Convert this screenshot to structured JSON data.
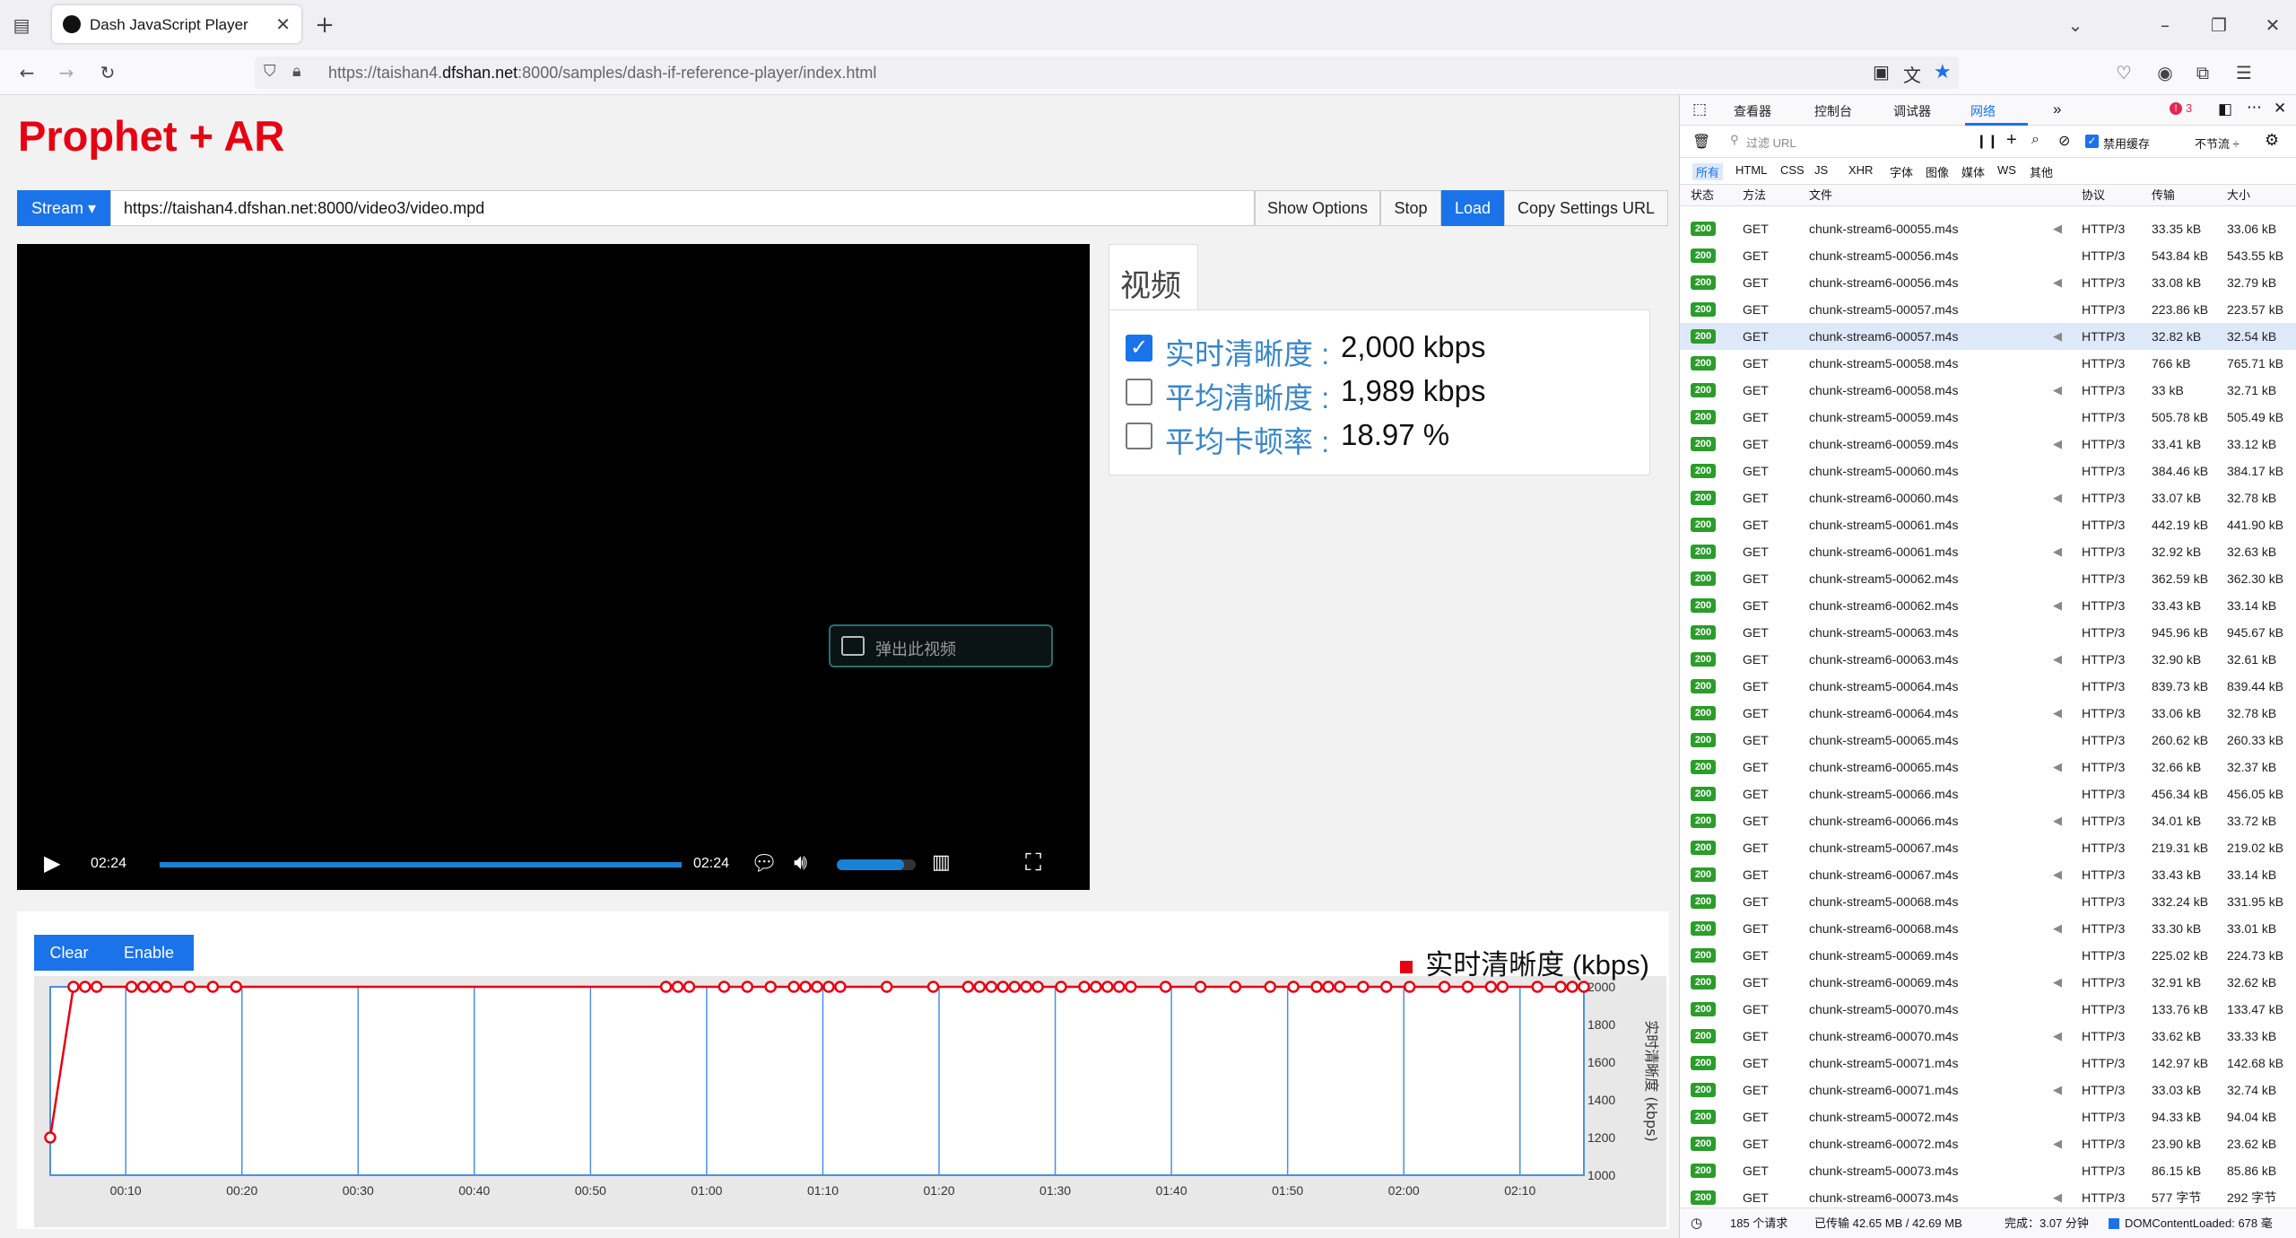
{
  "browser": {
    "tab_title": "Dash JavaScript Player",
    "url_prefix": "https://taishan4.",
    "url_domain": "dfshan.net",
    "url_suffix": ":8000/samples/dash-if-reference-player/index.html"
  },
  "page": {
    "title": "Prophet + AR",
    "stream_button": "Stream ▾",
    "stream_url": "https://taishan4.dfshan.net:8000/video3/video.mpd",
    "show_options": "Show Options",
    "stop": "Stop",
    "load": "Load",
    "copy_settings": "Copy Settings URL",
    "video": {
      "time_current": "02:24",
      "time_total": "02:24",
      "pip_label": "弹出此视频",
      "progress": 1.0,
      "volume": 0.85
    },
    "stats": {
      "tab_label": "视频",
      "items": [
        {
          "label": "实时清晰度 :",
          "value": "2,000 kbps",
          "checked": true
        },
        {
          "label": "平均清晰度 :",
          "value": "1,989 kbps",
          "checked": false
        },
        {
          "label": "平均卡顿率 :",
          "value": "18.97 %",
          "checked": false
        }
      ]
    },
    "chart_controls": {
      "clear": "Clear",
      "enable": "Enable"
    }
  },
  "chart_data": {
    "type": "line",
    "legend": "实时清晰度 (kbps)",
    "ylabel": "实时清晰度 (kbps)",
    "ylim": [
      1000,
      2000
    ],
    "xlim": [
      0,
      132
    ],
    "yticks": [
      "2000",
      "1800",
      "1600",
      "1400",
      "1200",
      "1000"
    ],
    "xticks": [
      "00:10",
      "00:20",
      "00:30",
      "00:40",
      "00:50",
      "01:00",
      "01:10",
      "01:20",
      "01:30",
      "01:40",
      "01:50",
      "02:00",
      "02:10"
    ],
    "x": [
      0,
      2,
      3,
      4,
      7,
      8,
      9,
      10,
      12,
      14,
      16,
      53,
      54,
      55,
      58,
      60,
      62,
      64,
      65,
      66,
      67,
      68,
      72,
      76,
      79,
      80,
      81,
      82,
      83,
      84,
      85,
      87,
      89,
      90,
      91,
      92,
      93,
      96,
      99,
      102,
      105,
      107,
      109,
      110,
      111,
      113,
      115,
      117,
      120,
      122,
      124,
      125,
      128,
      130,
      131,
      132
    ],
    "y": [
      1200,
      2000,
      2000,
      2000,
      2000,
      2000,
      2000,
      2000,
      2000,
      2000,
      2000,
      2000,
      2000,
      2000,
      2000,
      2000,
      2000,
      2000,
      2000,
      2000,
      2000,
      2000,
      2000,
      2000,
      2000,
      2000,
      2000,
      2000,
      2000,
      2000,
      2000,
      2000,
      2000,
      2000,
      2000,
      2000,
      2000,
      2000,
      2000,
      2000,
      2000,
      2000,
      2000,
      2000,
      2000,
      2000,
      2000,
      2000,
      2000,
      2000,
      2000,
      2000,
      2000,
      2000,
      2000,
      2000
    ]
  },
  "devtools": {
    "tabs": [
      "查看器",
      "控制台",
      "调试器",
      "网络"
    ],
    "error_count": "3",
    "filter_placeholder": "过滤 URL",
    "disable_cache": "禁用缓存",
    "throttle": "不节流 ÷",
    "type_filters": [
      "所有",
      "HTML",
      "CSS",
      "JS",
      "XHR",
      "字体",
      "图像",
      "媒体",
      "WS",
      "其他"
    ],
    "headers": {
      "status": "状态",
      "method": "方法",
      "file": "文件",
      "protocol": "协议",
      "transfer": "传输",
      "size": "大小"
    },
    "rows": [
      {
        "status": "200",
        "method": "GET",
        "file": "chunk-stream6-00055.m4s",
        "protocol": "HTTP/3",
        "transfer": "33.35 kB",
        "size": "33.06 kB"
      },
      {
        "status": "200",
        "method": "GET",
        "file": "chunk-stream5-00056.m4s",
        "protocol": "HTTP/3",
        "transfer": "543.84 kB",
        "size": "543.55 kB"
      },
      {
        "status": "200",
        "method": "GET",
        "file": "chunk-stream6-00056.m4s",
        "protocol": "HTTP/3",
        "transfer": "33.08 kB",
        "size": "32.79 kB"
      },
      {
        "status": "200",
        "method": "GET",
        "file": "chunk-stream5-00057.m4s",
        "protocol": "HTTP/3",
        "transfer": "223.86 kB",
        "size": "223.57 kB"
      },
      {
        "status": "200",
        "method": "GET",
        "file": "chunk-stream6-00057.m4s",
        "protocol": "HTTP/3",
        "transfer": "32.82 kB",
        "size": "32.54 kB"
      },
      {
        "status": "200",
        "method": "GET",
        "file": "chunk-stream5-00058.m4s",
        "protocol": "HTTP/3",
        "transfer": "766 kB",
        "size": "765.71 kB"
      },
      {
        "status": "200",
        "method": "GET",
        "file": "chunk-stream6-00058.m4s",
        "protocol": "HTTP/3",
        "transfer": "33 kB",
        "size": "32.71 kB"
      },
      {
        "status": "200",
        "method": "GET",
        "file": "chunk-stream5-00059.m4s",
        "protocol": "HTTP/3",
        "transfer": "505.78 kB",
        "size": "505.49 kB"
      },
      {
        "status": "200",
        "method": "GET",
        "file": "chunk-stream6-00059.m4s",
        "protocol": "HTTP/3",
        "transfer": "33.41 kB",
        "size": "33.12 kB"
      },
      {
        "status": "200",
        "method": "GET",
        "file": "chunk-stream5-00060.m4s",
        "protocol": "HTTP/3",
        "transfer": "384.46 kB",
        "size": "384.17 kB"
      },
      {
        "status": "200",
        "method": "GET",
        "file": "chunk-stream6-00060.m4s",
        "protocol": "HTTP/3",
        "transfer": "33.07 kB",
        "size": "32.78 kB"
      },
      {
        "status": "200",
        "method": "GET",
        "file": "chunk-stream5-00061.m4s",
        "protocol": "HTTP/3",
        "transfer": "442.19 kB",
        "size": "441.90 kB"
      },
      {
        "status": "200",
        "method": "GET",
        "file": "chunk-stream6-00061.m4s",
        "protocol": "HTTP/3",
        "transfer": "32.92 kB",
        "size": "32.63 kB"
      },
      {
        "status": "200",
        "method": "GET",
        "file": "chunk-stream5-00062.m4s",
        "protocol": "HTTP/3",
        "transfer": "362.59 kB",
        "size": "362.30 kB"
      },
      {
        "status": "200",
        "method": "GET",
        "file": "chunk-stream6-00062.m4s",
        "protocol": "HTTP/3",
        "transfer": "33.43 kB",
        "size": "33.14 kB"
      },
      {
        "status": "200",
        "method": "GET",
        "file": "chunk-stream5-00063.m4s",
        "protocol": "HTTP/3",
        "transfer": "945.96 kB",
        "size": "945.67 kB"
      },
      {
        "status": "200",
        "method": "GET",
        "file": "chunk-stream6-00063.m4s",
        "protocol": "HTTP/3",
        "transfer": "32.90 kB",
        "size": "32.61 kB"
      },
      {
        "status": "200",
        "method": "GET",
        "file": "chunk-stream5-00064.m4s",
        "protocol": "HTTP/3",
        "transfer": "839.73 kB",
        "size": "839.44 kB"
      },
      {
        "status": "200",
        "method": "GET",
        "file": "chunk-stream6-00064.m4s",
        "protocol": "HTTP/3",
        "transfer": "33.06 kB",
        "size": "32.78 kB"
      },
      {
        "status": "200",
        "method": "GET",
        "file": "chunk-stream5-00065.m4s",
        "protocol": "HTTP/3",
        "transfer": "260.62 kB",
        "size": "260.33 kB"
      },
      {
        "status": "200",
        "method": "GET",
        "file": "chunk-stream6-00065.m4s",
        "protocol": "HTTP/3",
        "transfer": "32.66 kB",
        "size": "32.37 kB"
      },
      {
        "status": "200",
        "method": "GET",
        "file": "chunk-stream5-00066.m4s",
        "protocol": "HTTP/3",
        "transfer": "456.34 kB",
        "size": "456.05 kB"
      },
      {
        "status": "200",
        "method": "GET",
        "file": "chunk-stream6-00066.m4s",
        "protocol": "HTTP/3",
        "transfer": "34.01 kB",
        "size": "33.72 kB"
      },
      {
        "status": "200",
        "method": "GET",
        "file": "chunk-stream5-00067.m4s",
        "protocol": "HTTP/3",
        "transfer": "219.31 kB",
        "size": "219.02 kB"
      },
      {
        "status": "200",
        "method": "GET",
        "file": "chunk-stream6-00067.m4s",
        "protocol": "HTTP/3",
        "transfer": "33.43 kB",
        "size": "33.14 kB"
      },
      {
        "status": "200",
        "method": "GET",
        "file": "chunk-stream5-00068.m4s",
        "protocol": "HTTP/3",
        "transfer": "332.24 kB",
        "size": "331.95 kB"
      },
      {
        "status": "200",
        "method": "GET",
        "file": "chunk-stream6-00068.m4s",
        "protocol": "HTTP/3",
        "transfer": "33.30 kB",
        "size": "33.01 kB"
      },
      {
        "status": "200",
        "method": "GET",
        "file": "chunk-stream5-00069.m4s",
        "protocol": "HTTP/3",
        "transfer": "225.02 kB",
        "size": "224.73 kB"
      },
      {
        "status": "200",
        "method": "GET",
        "file": "chunk-stream6-00069.m4s",
        "protocol": "HTTP/3",
        "transfer": "32.91 kB",
        "size": "32.62 kB"
      },
      {
        "status": "200",
        "method": "GET",
        "file": "chunk-stream5-00070.m4s",
        "protocol": "HTTP/3",
        "transfer": "133.76 kB",
        "size": "133.47 kB"
      },
      {
        "status": "200",
        "method": "GET",
        "file": "chunk-stream6-00070.m4s",
        "protocol": "HTTP/3",
        "transfer": "33.62 kB",
        "size": "33.33 kB"
      },
      {
        "status": "200",
        "method": "GET",
        "file": "chunk-stream5-00071.m4s",
        "protocol": "HTTP/3",
        "transfer": "142.97 kB",
        "size": "142.68 kB"
      },
      {
        "status": "200",
        "method": "GET",
        "file": "chunk-stream6-00071.m4s",
        "protocol": "HTTP/3",
        "transfer": "33.03 kB",
        "size": "32.74 kB"
      },
      {
        "status": "200",
        "method": "GET",
        "file": "chunk-stream5-00072.m4s",
        "protocol": "HTTP/3",
        "transfer": "94.33 kB",
        "size": "94.04 kB"
      },
      {
        "status": "200",
        "method": "GET",
        "file": "chunk-stream6-00072.m4s",
        "protocol": "HTTP/3",
        "transfer": "23.90 kB",
        "size": "23.62 kB"
      },
      {
        "status": "200",
        "method": "GET",
        "file": "chunk-stream5-00073.m4s",
        "protocol": "HTTP/3",
        "transfer": "86.15 kB",
        "size": "85.86 kB"
      },
      {
        "status": "200",
        "method": "GET",
        "file": "chunk-stream6-00073.m4s",
        "protocol": "HTTP/3",
        "transfer": "577 字节",
        "size": "292 字节"
      }
    ],
    "footer": {
      "requests": "185 个请求",
      "transferred": "已传输 42.65 MB / 42.69 MB",
      "finish": "完成：3.07 分钟",
      "dcl": "DOMContentLoaded: 678 毫"
    }
  },
  "colors": {
    "accent": "#1a73e8",
    "title_red": "#e60012",
    "chart_line": "#e60012",
    "chart_grid": "#4a90e2",
    "status_green": "#2a9d2a"
  }
}
